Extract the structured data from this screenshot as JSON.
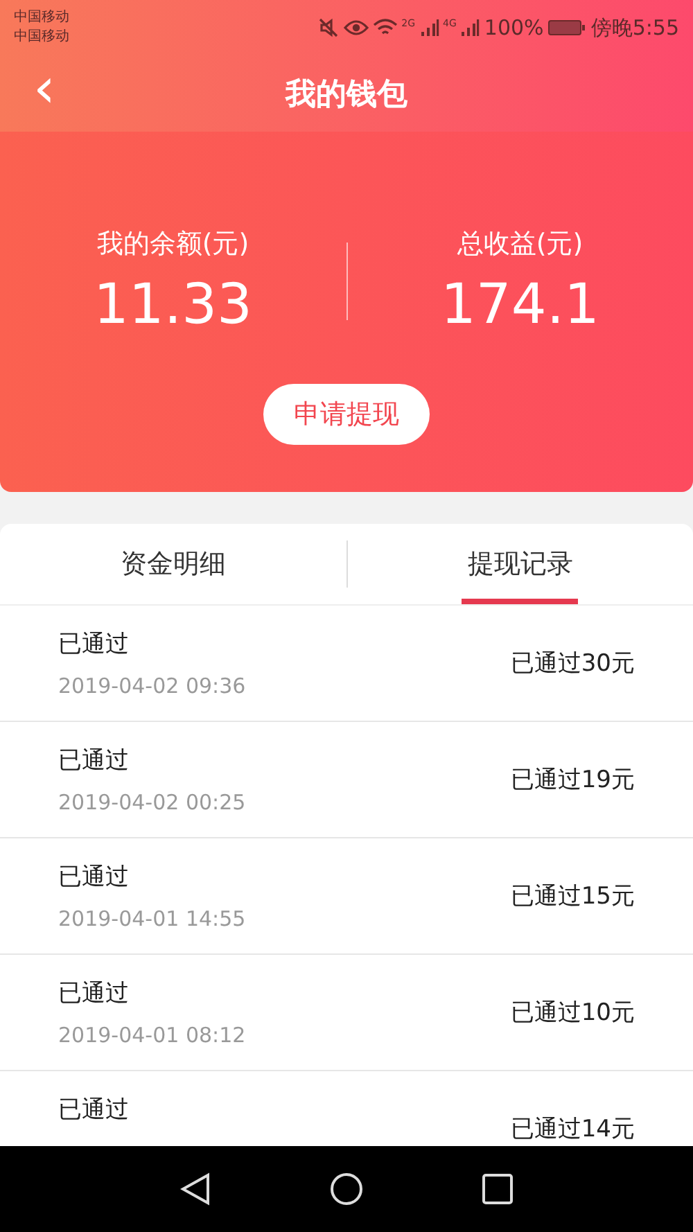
{
  "status_bar": {
    "carriers": [
      "中国移动",
      "中国移动"
    ],
    "sim1_label": "2G",
    "sim2_label": "4G",
    "battery": "100%",
    "time": "傍晚5:55"
  },
  "header": {
    "back": "‹",
    "title": "我的钱包"
  },
  "summary": {
    "balance_label": "我的余额(元)",
    "balance": "11.33",
    "income_label": "总收益(元)",
    "income": "174.1",
    "button": "申请提现"
  },
  "tabs": [
    {
      "label": "资金明细",
      "selected": false
    },
    {
      "label": "提现记录",
      "selected": true
    }
  ],
  "records": [
    {
      "status": "已通过",
      "date": "2019-04-02 09:36",
      "amount": "已通过30元"
    },
    {
      "status": "已通过",
      "date": "2019-04-02 00:25",
      "amount": "已通过19元"
    },
    {
      "status": "已通过",
      "date": "2019-04-01 14:55",
      "amount": "已通过15元"
    },
    {
      "status": "已通过",
      "date": "2019-04-01 08:12",
      "amount": "已通过10元"
    },
    {
      "status": "已通过",
      "amount": "已通过14元"
    }
  ]
}
